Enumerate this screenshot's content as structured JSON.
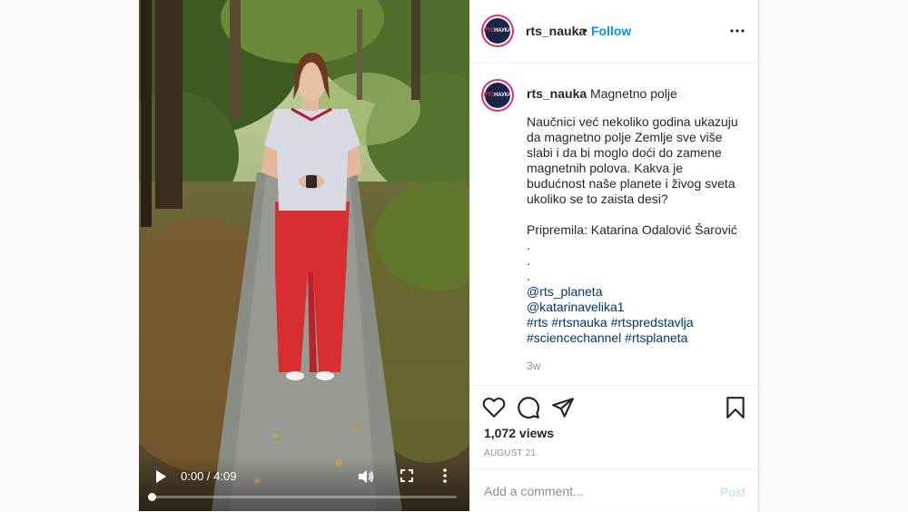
{
  "video": {
    "time_display": "0:00 / 4:09",
    "progress_fraction": 0.0
  },
  "header": {
    "avatar_text_a": "РТС",
    "avatar_text_b": "НАУКА",
    "username": "rts_nauka",
    "separator": "•",
    "follow_label": "Follow"
  },
  "caption": {
    "username": "rts_nauka",
    "title": "Magnetno polje",
    "paragraph": "Naučnici već nekoliko godina ukazuju da magnetno polje Zemlje sve više slabi i da bi moglo doći do zamene magnetnih polova. Kakva je budućnost naše planete i živog sveta ukoliko se to zaista desi?",
    "credit": "Pripremila: Katarina Odalović Šarović",
    "dots": [
      ".",
      ".",
      "."
    ],
    "mention_1": "@rts_planeta",
    "mention_2": "@katarinavelika1",
    "hashtags_line1": "#rts #rtsnauka #rtspredstavlja",
    "hashtags_line2": "#sciencechannel #rtsplaneta",
    "time_ago": "3w"
  },
  "stats": {
    "views": "1,072 views",
    "date": "AUGUST 21"
  },
  "comment": {
    "placeholder": "Add a comment...",
    "post_label": "Post"
  },
  "colors": {
    "accent_link": "#0095f6",
    "mention_link": "#00376b",
    "post_disabled": "#b2dffc"
  },
  "icons": {
    "like": "heart-icon",
    "comment": "comment-bubble-icon",
    "share": "paper-plane-icon",
    "save": "bookmark-icon",
    "play": "play-icon",
    "volume": "volume-icon",
    "fullscreen": "fullscreen-icon"
  }
}
